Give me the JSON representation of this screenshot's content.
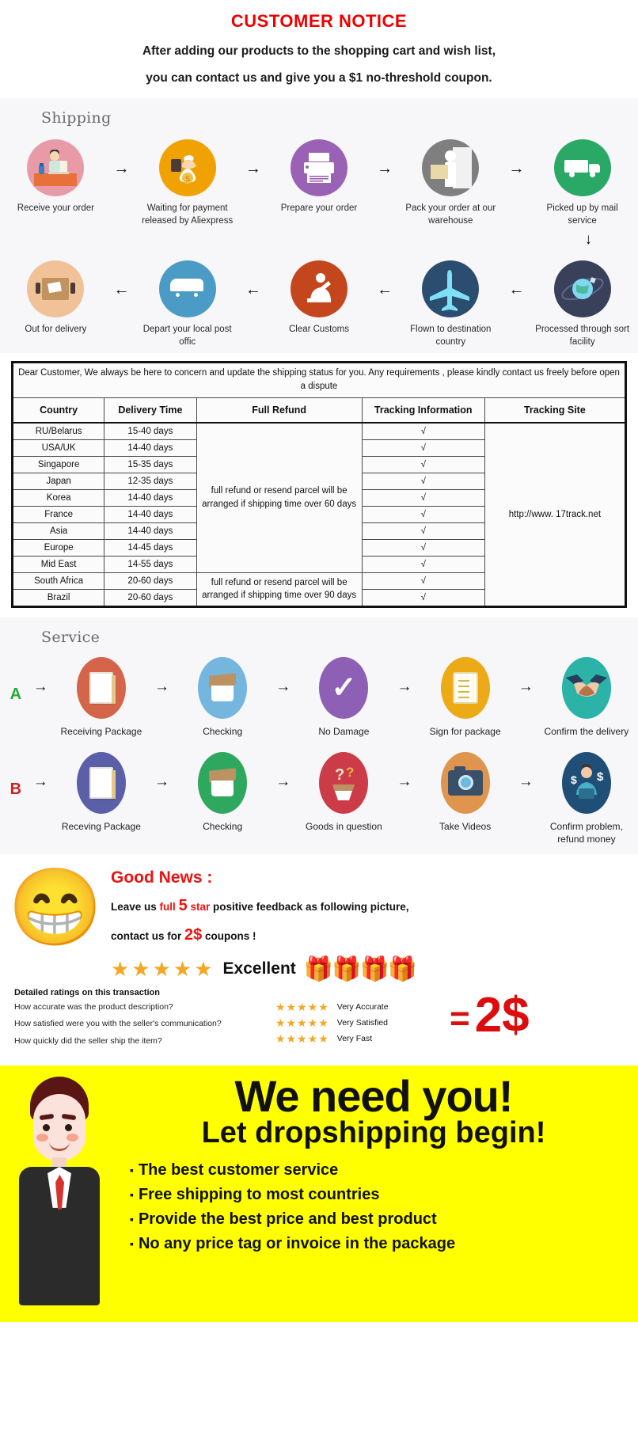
{
  "notice": {
    "title": "CUSTOMER NOTICE",
    "line1": "After adding our products to the shopping cart and wish list,",
    "line2": "you can contact us and give you a $1 no-threshold coupon."
  },
  "shipping": {
    "title": "Shipping",
    "row1": [
      {
        "label": "Receive your order",
        "icon": "person-at-desk-icon",
        "color": "#e89aa6"
      },
      {
        "label": "Waiting for payment released by Aliexpress",
        "icon": "money-bag-hand-icon",
        "color": "#f0a202"
      },
      {
        "label": "Prepare your order",
        "icon": "printer-icon",
        "color": "#9a62b5"
      },
      {
        "label": "Pack your order at our warehouse",
        "icon": "worker-packing-icon",
        "color": "#7f7f7f"
      },
      {
        "label": "Picked up by mail service",
        "icon": "delivery-truck-icon",
        "color": "#2aa866"
      }
    ],
    "row2": [
      {
        "label": "Out for delivery",
        "icon": "parcel-box-icon",
        "color": "#f1c197"
      },
      {
        "label": "Depart your local post offic",
        "icon": "delivery-van-icon",
        "color": "#4a9cc7"
      },
      {
        "label": "Clear  Customs",
        "icon": "customs-officer-icon",
        "color": "#c4461c"
      },
      {
        "label": "Flown to destination country",
        "icon": "airplane-icon",
        "color": "#2b4d6f"
      },
      {
        "label": "Processed through sort facility",
        "icon": "globe-satellite-icon",
        "color": "#39405a"
      }
    ],
    "arrow_right": "→",
    "arrow_left": "←",
    "arrow_down": "↓"
  },
  "table": {
    "notice_text": "Dear Customer, We always be here to concern and update the shipping status for you.  Any requirements , please kindly contact us freely before open a dispute",
    "headers": [
      "Country",
      "Delivery Time",
      "Full Refund",
      "Tracking Information",
      "Tracking Site"
    ],
    "refund_1": "full refund or resend parcel will be arranged if shipping time over 60 days",
    "refund_2": "full refund or resend parcel will be arranged if shipping time over 90 days",
    "tracking_site": "http://www. 17track.net",
    "check": "√",
    "rows": [
      {
        "country": "RU/Belarus",
        "time": "15-40 days",
        "check": "√"
      },
      {
        "country": "USA/UK",
        "time": "14-40 days",
        "check": "√"
      },
      {
        "country": "Singapore",
        "time": "15-35 days",
        "check": "√"
      },
      {
        "country": "Japan",
        "time": "12-35 days",
        "check": "√"
      },
      {
        "country": "Korea",
        "time": "14-40 days",
        "check": "√"
      },
      {
        "country": "France",
        "time": "14-40 days",
        "check": "√"
      },
      {
        "country": "Asia",
        "time": "14-40 days",
        "check": "√"
      },
      {
        "country": "Europe",
        "time": "14-45 days",
        "check": "√"
      },
      {
        "country": "Mid East",
        "time": "14-55 days",
        "check": "√"
      },
      {
        "country": "South Africa",
        "time": "20-60 days",
        "check": "√"
      },
      {
        "country": "Brazil",
        "time": "20-60 days",
        "check": "√"
      }
    ]
  },
  "service": {
    "title": "Service",
    "rowA_letter": "A",
    "rowB_letter": "B",
    "arrow": "→",
    "rowA": [
      {
        "label": "Receiving Package",
        "icon": "book-package-icon",
        "color": "#d4654a"
      },
      {
        "label": "Checking",
        "icon": "open-box-icon",
        "color": "#74b6dd"
      },
      {
        "label": "No Damage",
        "icon": "checkmark-icon",
        "color": "#8d5fb5"
      },
      {
        "label": "Sign for package",
        "icon": "signed-clipboard-icon",
        "color": "#ecaa16"
      },
      {
        "label": "Confirm the delivery",
        "icon": "handshake-icon",
        "color": "#2ab3a6"
      }
    ],
    "rowB": [
      {
        "label": "Receving Package",
        "icon": "book-package-icon",
        "color": "#5a5fa8"
      },
      {
        "label": "Checking",
        "icon": "open-box-icon",
        "color": "#2fa85f"
      },
      {
        "label": "Goods in question",
        "icon": "question-box-icon",
        "color": "#cc3c48"
      },
      {
        "label": "Take Videos",
        "icon": "camera-icon",
        "color": "#e0954e"
      },
      {
        "label": "Confirm problem, refund money",
        "icon": "refund-person-icon",
        "color": "#1f4f77"
      }
    ]
  },
  "goodnews": {
    "emoji": "😁",
    "title": "Good News :",
    "line1_a": "Leave us ",
    "line1_full": "full",
    "line1_five": "5",
    "line1_star": "star",
    "line1_b": " positive feedback as following picture,",
    "line2_a": "contact us for ",
    "line2_amount": "2$",
    "line2_b": " coupons !",
    "stars": "★★★★★",
    "excellent": "Excellent",
    "gifts": "🎁🎁🎁🎁",
    "ratings_head": "Detailed ratings on this transaction",
    "ratings": [
      {
        "question": "How accurate was the product description?",
        "stars": "★★★★★",
        "value": "Very Accurate"
      },
      {
        "question": "How satisfied were you with the seller's communication?",
        "stars": "★★★★★",
        "value": "Very Satisfied"
      },
      {
        "question": "How quickly did the seller ship the item?",
        "stars": "★★★★★",
        "value": "Very Fast"
      }
    ],
    "equals": "=",
    "reward": "2$"
  },
  "banner": {
    "headline": "We need you!",
    "subhead": "Let dropshipping begin!",
    "bullet": "▪",
    "items": [
      "The best customer service",
      "Free shipping to most countries",
      "Provide the best price and best product",
      "No any price tag or invoice in the package"
    ],
    "background": "#ffff00"
  }
}
